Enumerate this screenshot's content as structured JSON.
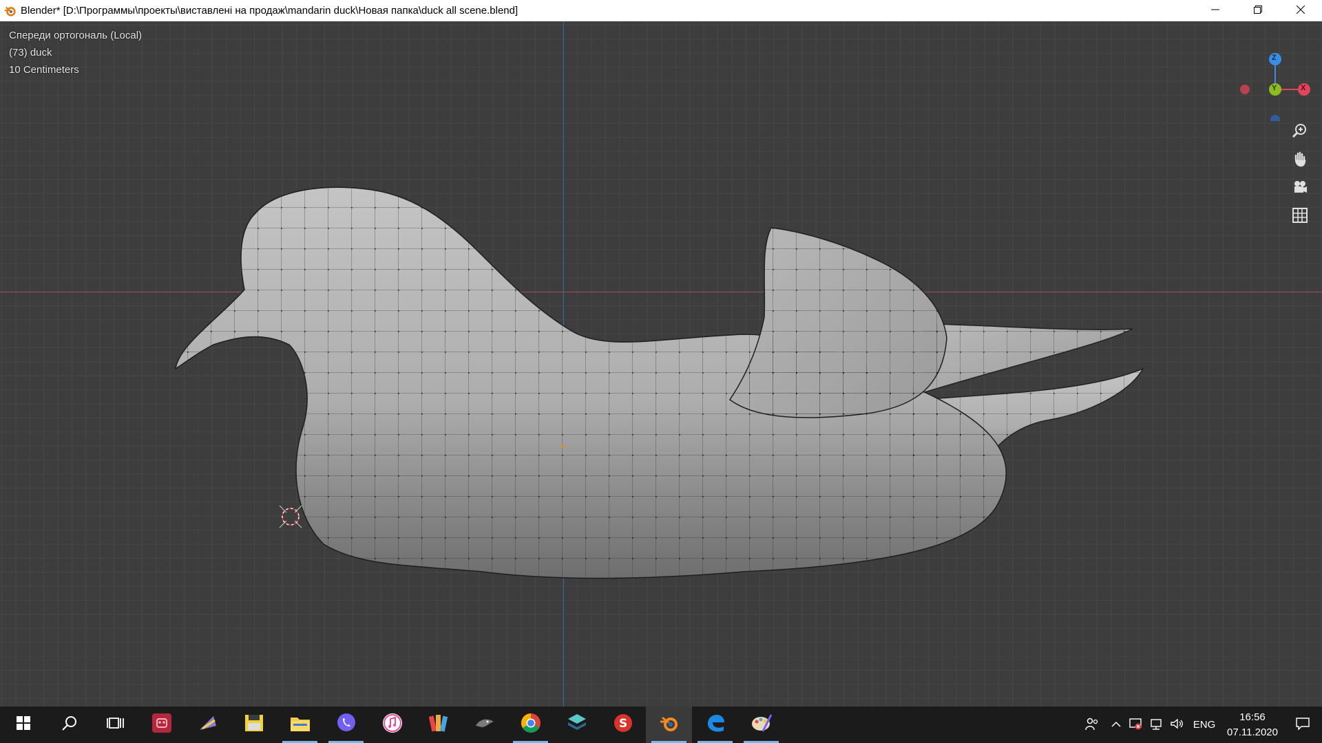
{
  "window": {
    "title": "Blender* [D:\\Программы\\проекты\\виставлені на продаж\\mandarin duck\\Новая папка\\duck all scene.blend]",
    "minimize_icon": "minimize-icon",
    "restore_icon": "restore-icon",
    "close_icon": "close-icon"
  },
  "viewport": {
    "view_name": "Спереди ортогональ (Local)",
    "object_info": "(73) duck",
    "grid_scale": "10 Centimeters",
    "gizmo": {
      "z": "Z",
      "y": "Y",
      "x": "X"
    },
    "nav_icons": [
      "zoom-icon",
      "hand-pan-icon",
      "camera-icon",
      "grid-icon"
    ],
    "colors": {
      "x_axis": "#e5435a",
      "y_axis": "#8bbc22",
      "z_axis": "#3a8ee6",
      "mesh": "#b4b4b4"
    }
  },
  "taskbar": {
    "items": [
      {
        "name": "start-button",
        "icon": "windows-icon"
      },
      {
        "name": "search-button",
        "icon": "search-icon"
      },
      {
        "name": "task-view-button",
        "icon": "task-view-icon"
      },
      {
        "name": "app-red-robot",
        "icon": "robot-app-icon"
      },
      {
        "name": "app-paint-purple",
        "icon": "paint-app-icon"
      },
      {
        "name": "app-total-commander",
        "icon": "floppy-app-icon"
      },
      {
        "name": "app-file-explorer",
        "icon": "folder-icon",
        "running": true
      },
      {
        "name": "app-viber",
        "icon": "viber-icon",
        "running": true
      },
      {
        "name": "app-itunes",
        "icon": "music-icon"
      },
      {
        "name": "app-color-cards",
        "icon": "color-cards-icon"
      },
      {
        "name": "app-dark-creature",
        "icon": "creature-app-icon"
      },
      {
        "name": "app-chrome",
        "icon": "chrome-icon",
        "running": true
      },
      {
        "name": "app-layers",
        "icon": "layers-icon"
      },
      {
        "name": "app-substance",
        "icon": "substance-icon"
      },
      {
        "name": "app-blender",
        "icon": "blender-icon",
        "running": true,
        "active": true
      },
      {
        "name": "app-edge",
        "icon": "edge-icon",
        "running": true
      },
      {
        "name": "app-paint-palette",
        "icon": "palette-icon",
        "running": true
      }
    ],
    "tray": {
      "language": "ENG",
      "time": "16:56",
      "date": "07.11.2020"
    }
  }
}
